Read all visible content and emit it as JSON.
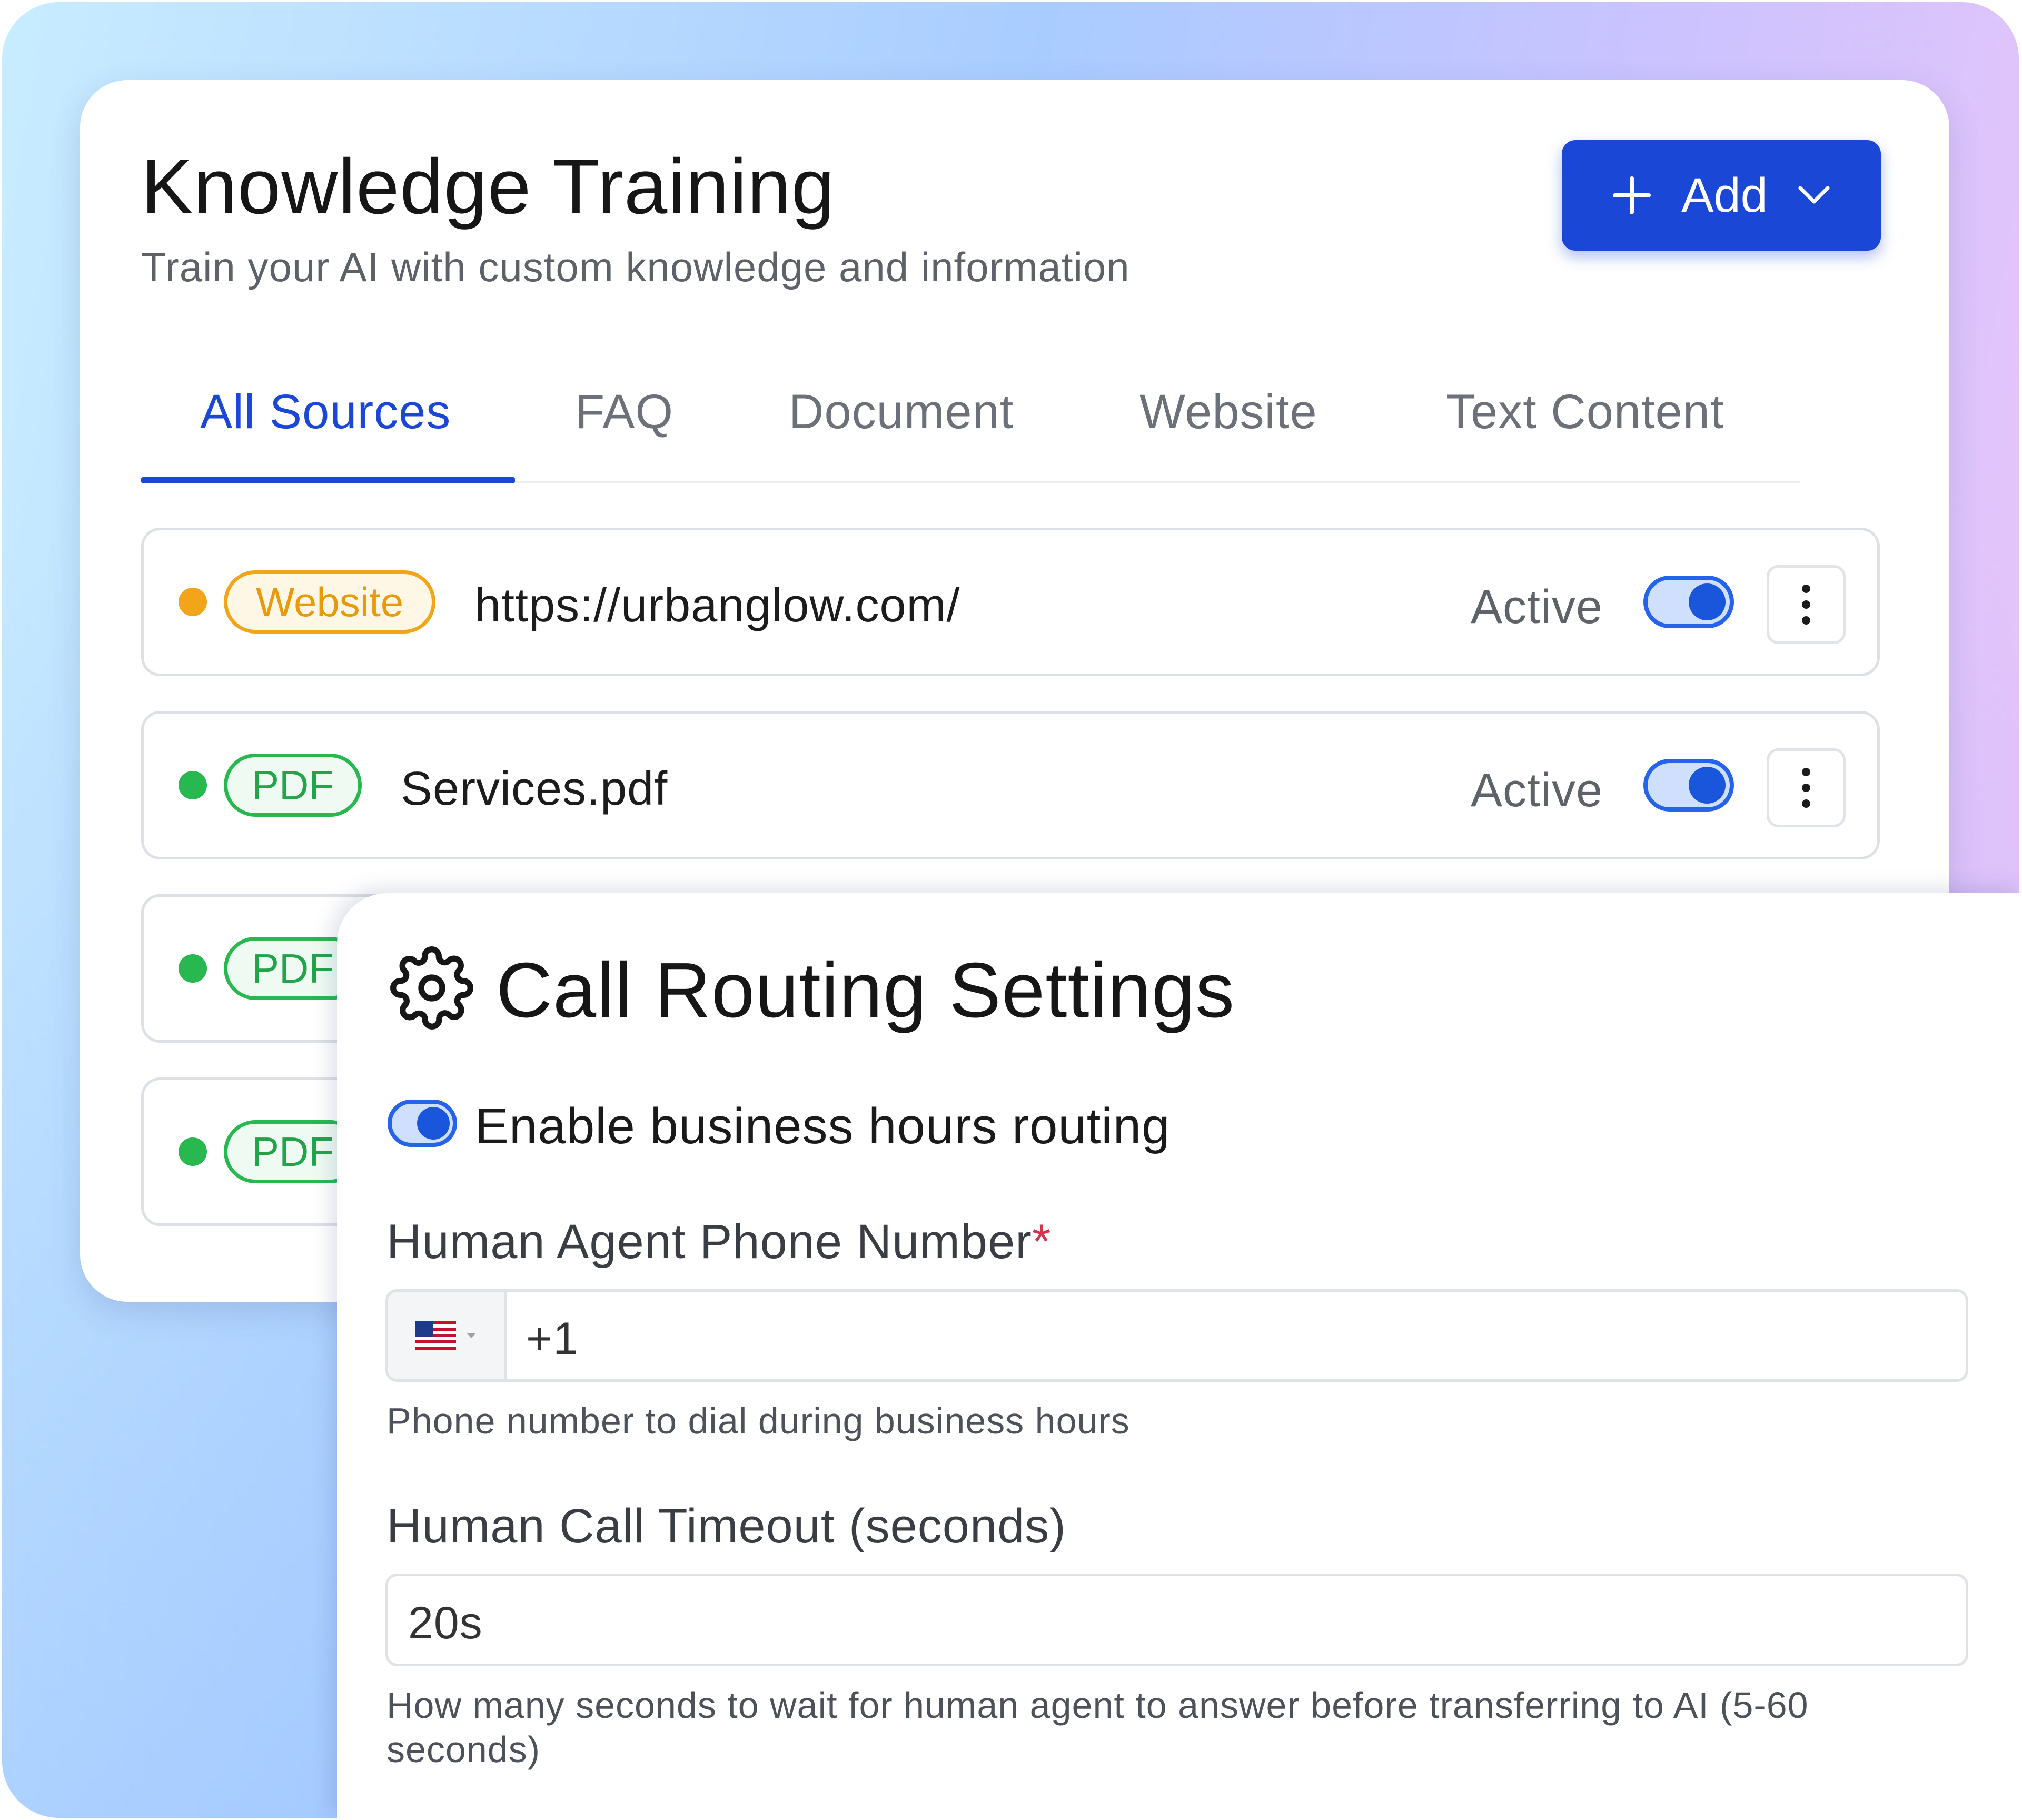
{
  "knowledge": {
    "title": "Knowledge Training",
    "subtitle": "Train your AI with custom knowledge and information",
    "add_button": {
      "label": "Add",
      "icon_left": "plus-icon",
      "icon_right": "chevron-down-icon"
    },
    "tabs": [
      {
        "label": "All Sources",
        "active": true
      },
      {
        "label": "FAQ",
        "active": false
      },
      {
        "label": "Document",
        "active": false
      },
      {
        "label": "Website",
        "active": false
      },
      {
        "label": "Text Content",
        "active": false
      }
    ],
    "sources": [
      {
        "type": "Website",
        "name": "https://urbanglow.com/",
        "status": "Active",
        "enabled": true,
        "dot_color": "#f3a51a"
      },
      {
        "type": "PDF",
        "name": "Services.pdf",
        "status": "Active",
        "enabled": true,
        "dot_color": "#27b94f"
      },
      {
        "type": "PDF",
        "dot_color": "#27b94f"
      },
      {
        "type": "PDF",
        "dot_color": "#27b94f"
      }
    ]
  },
  "call_routing": {
    "title": "Call Routing Settings",
    "icon": "gear-icon",
    "business_hours_toggle": {
      "label": "Enable business hours routing",
      "enabled": true
    },
    "phone_field": {
      "label": "Human Agent Phone Number",
      "required_marker": "*",
      "country": "US",
      "value": "+1",
      "hint": "Phone number to dial during business hours"
    },
    "timeout_field": {
      "label": "Human Call Timeout (seconds)",
      "value": "20s",
      "hint": "How many seconds to wait for human agent to answer before transferring to AI (5-60 seconds)"
    }
  },
  "colors": {
    "accent": "#1a47d6",
    "website_badge": "#f3a51a",
    "pdf_badge": "#27b94f",
    "required": "#d6334c"
  }
}
